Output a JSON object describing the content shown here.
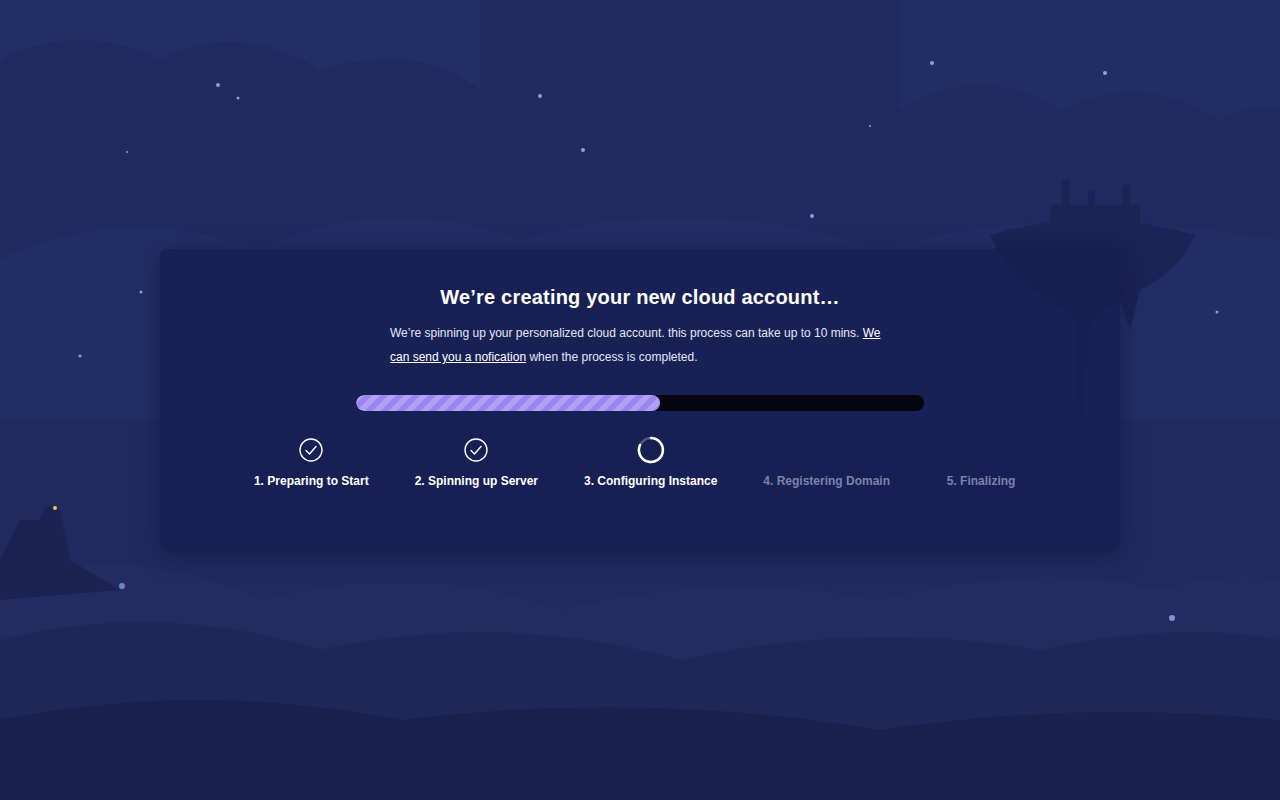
{
  "title": "We’re creating your new cloud account…",
  "description": {
    "before": "We’re spinning up your personalized cloud account. this process can take up to 10 mins. ",
    "link": "We can send you a nofication",
    "after": " when the process is completed."
  },
  "progress": {
    "level": 0.535
  },
  "steps": [
    {
      "label": "1. Preparing to Start",
      "kind": "done"
    },
    {
      "label": "2. Spinning up Server",
      "kind": "done"
    },
    {
      "label": "3. Configuring Instance",
      "kind": "active"
    },
    {
      "label": "4. Registering Domain",
      "kind": "pending"
    },
    {
      "label": "5. Finalizing",
      "kind": "pending"
    }
  ]
}
